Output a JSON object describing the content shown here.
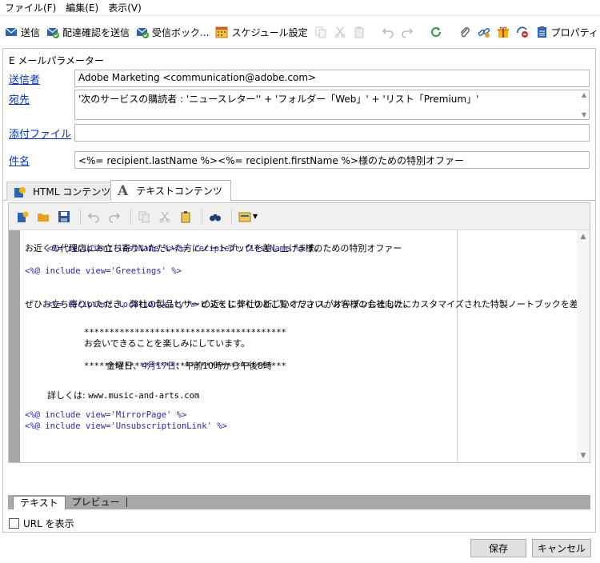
{
  "menu": [
    "ファイル(F)",
    "編集(E)",
    "表示(V)"
  ],
  "toolbar": {
    "send": "送信",
    "send_proof": "配達確認を送信",
    "inbox": "受信ボック...",
    "schedule": "スケジュール設定",
    "properties": "プロパティ"
  },
  "params": {
    "section_title": "E メールパラメーター",
    "sender_label": "送信者",
    "sender_value": "Adobe Marketing  <communication@adobe.com>",
    "to_label": "宛先",
    "to_value": "'次のサービスの購読者 : 'ニュースレター'' + 'フォルダー「Web」' + 'リスト「Premium」'",
    "attach_label": "添付ファイル",
    "attach_value": "",
    "subject_label": "件名",
    "subject_value": "<%= recipient.lastName %><%= recipient.firstName %>様のための特別オファー"
  },
  "tabs": {
    "html": "HTML コンテンツ",
    "text": "テキストコンテンツ"
  },
  "editor": {
    "line1_code": "<%= recipient.lastName %><%= recipient.firstName %>",
    "line1_text": "様のための特別オファー",
    "line2": "お近くの代理店にお立ち寄りいただいた方にノートブックを差し上げます。",
    "line3": "<%@ include view='Greetings' %>",
    "line4_code": "<%= recipient.location.city %>",
    "line4_text": " の近くに弊社の新しいオフィスがオープンしました。",
    "line5": "ぜひお立ち寄りいただき、弊社の製品とサービスをじっくりとご覧ください。お客様の会社向けにカスタマイズされた特製ノートブックを差し上げます。",
    "stars": "****************************************",
    "line7": "お会いできることを楽しみにしています。",
    "line8_a": "金曜日、",
    "line8_b": "4月17日",
    "line8_c": "、午前10時から午後8時",
    "line9_label": "詳しくは: ",
    "line9_url": "www.music-and-arts.com",
    "line10": "<%@ include view='MirrorPage' %>",
    "line11": "<%@ include view='UnsubscriptionLink' %>"
  },
  "bottom_tabs": {
    "text": "テキスト",
    "preview": "プレビュー"
  },
  "show_url_label": "URL を表示",
  "buttons": {
    "save": "保存",
    "cancel": "キャンセル"
  }
}
